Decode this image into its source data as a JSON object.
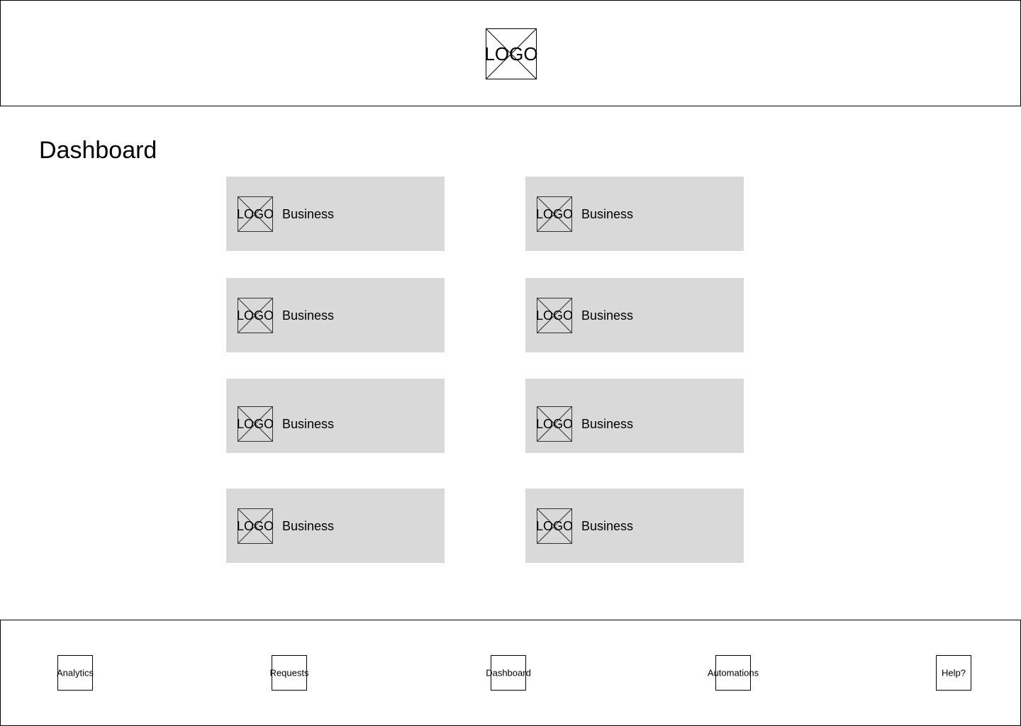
{
  "header": {
    "logo_text": "LOGO",
    "logo_icon": "image-placeholder-icon"
  },
  "main": {
    "title": "Dashboard",
    "cards": [
      {
        "logo_text": "LOGO",
        "label": "Business"
      },
      {
        "logo_text": "LOGO",
        "label": "Business"
      },
      {
        "logo_text": "LOGO",
        "label": "Business"
      },
      {
        "logo_text": "LOGO",
        "label": "Business"
      },
      {
        "logo_text": "LOGO",
        "label": "Business"
      },
      {
        "logo_text": "LOGO",
        "label": "Business"
      },
      {
        "logo_text": "LOGO",
        "label": "Business"
      },
      {
        "logo_text": "LOGO",
        "label": "Business"
      }
    ],
    "card_background": "#d9d9d9"
  },
  "footer": {
    "nav": [
      {
        "label": "Analytics"
      },
      {
        "label": "Requests"
      },
      {
        "label": "Dashboard"
      },
      {
        "label": "Automations"
      },
      {
        "label": "Help?"
      }
    ]
  }
}
